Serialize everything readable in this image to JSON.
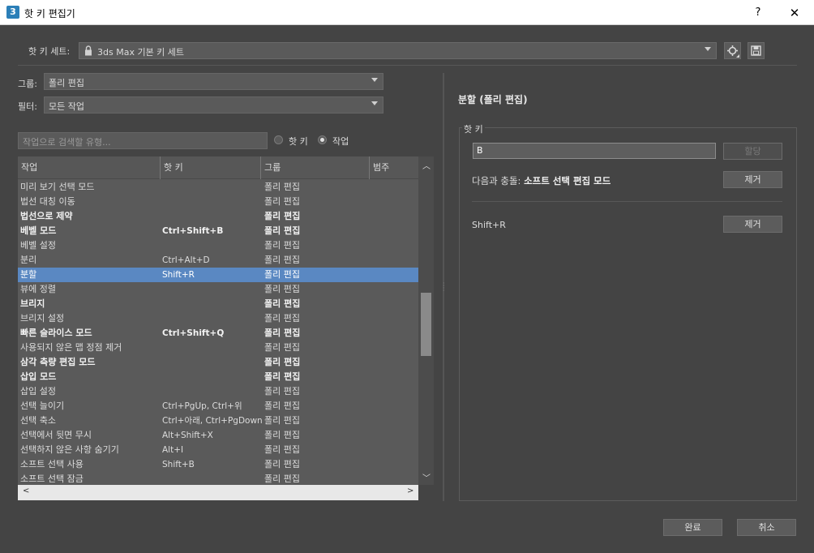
{
  "window": {
    "title": "핫 키 편집기",
    "app_icon_text": "3",
    "help_label": "?",
    "close_label": "✕"
  },
  "hotkey_set": {
    "label": "핫 키 세트:",
    "value": "3ds Max 기본 키 세트"
  },
  "filters": {
    "group_label": "그룹:",
    "group_value": "폴리 편집",
    "filter_label": "필터:",
    "filter_value": "모든 작업",
    "search_placeholder": "작업으로 검색할 유형...",
    "radio_hotkey": "핫 키",
    "radio_action": "작업",
    "selected_radio": "action"
  },
  "table": {
    "columns": [
      "작업",
      "핫 키",
      "그룹",
      "범주"
    ],
    "rows": [
      {
        "action": "미리 보기 선택 모드",
        "hotkey": "",
        "group": "폴리 편집",
        "bold": false
      },
      {
        "action": "법선 대칭 이동",
        "hotkey": "",
        "group": "폴리 편집",
        "bold": false
      },
      {
        "action": "법선으로 제약",
        "hotkey": "",
        "group": "폴리 편집",
        "bold": true
      },
      {
        "action": "베벨 모드",
        "hotkey": "Ctrl+Shift+B",
        "group": "폴리 편집",
        "bold": true
      },
      {
        "action": "베벨 설정",
        "hotkey": "",
        "group": "폴리 편집",
        "bold": false
      },
      {
        "action": "분리",
        "hotkey": "Ctrl+Alt+D",
        "group": "폴리 편집",
        "bold": false
      },
      {
        "action": "분할",
        "hotkey": "Shift+R",
        "group": "폴리 편집",
        "bold": false,
        "selected": true
      },
      {
        "action": "뷰에 정렬",
        "hotkey": "",
        "group": "폴리 편집",
        "bold": false
      },
      {
        "action": "브리지",
        "hotkey": "",
        "group": "폴리 편집",
        "bold": true
      },
      {
        "action": "브리지 설정",
        "hotkey": "",
        "group": "폴리 편집",
        "bold": false
      },
      {
        "action": "빠른 슬라이스 모드",
        "hotkey": "Ctrl+Shift+Q",
        "group": "폴리 편집",
        "bold": true
      },
      {
        "action": "사용되지 않은 맵 정점 제거",
        "hotkey": "",
        "group": "폴리 편집",
        "bold": false
      },
      {
        "action": "삼각 측량 편집 모드",
        "hotkey": "",
        "group": "폴리 편집",
        "bold": true
      },
      {
        "action": "삽입 모드",
        "hotkey": "",
        "group": "폴리 편집",
        "bold": true
      },
      {
        "action": "삽입 설정",
        "hotkey": "",
        "group": "폴리 편집",
        "bold": false
      },
      {
        "action": "선택 늘이기",
        "hotkey": "Ctrl+PgUp, Ctrl+위",
        "group": "폴리 편집",
        "bold": false
      },
      {
        "action": "선택 축소",
        "hotkey": "Ctrl+아래, Ctrl+PgDown",
        "group": "폴리 편집",
        "bold": false
      },
      {
        "action": "선택에서 뒷면 무시",
        "hotkey": "Alt+Shift+X",
        "group": "폴리 편집",
        "bold": false
      },
      {
        "action": "선택하지 않은 사항 숨기기",
        "hotkey": "Alt+I",
        "group": "폴리 편집",
        "bold": false
      },
      {
        "action": "소프트 선택 사용",
        "hotkey": "Shift+B",
        "group": "폴리 편집",
        "bold": false
      },
      {
        "action": "소프트 선택 잠금",
        "hotkey": "",
        "group": "폴리 편집",
        "bold": false
      }
    ]
  },
  "details": {
    "title": "분할 (폴리 편집)",
    "hotkey_group_label": "핫 키",
    "hotkey_input_value": "B",
    "assign_label": "할당",
    "conflict_prefix": "다음과 충돌:",
    "conflict_action": "소프트 선택 편집 모드",
    "remove_label": "제거",
    "assigned_hotkey": "Shift+R",
    "remove_label_2": "제거"
  },
  "footer": {
    "ok_label": "완료",
    "cancel_label": "취소"
  },
  "colors": {
    "background": "#444444",
    "selection": "#5a88c2"
  }
}
